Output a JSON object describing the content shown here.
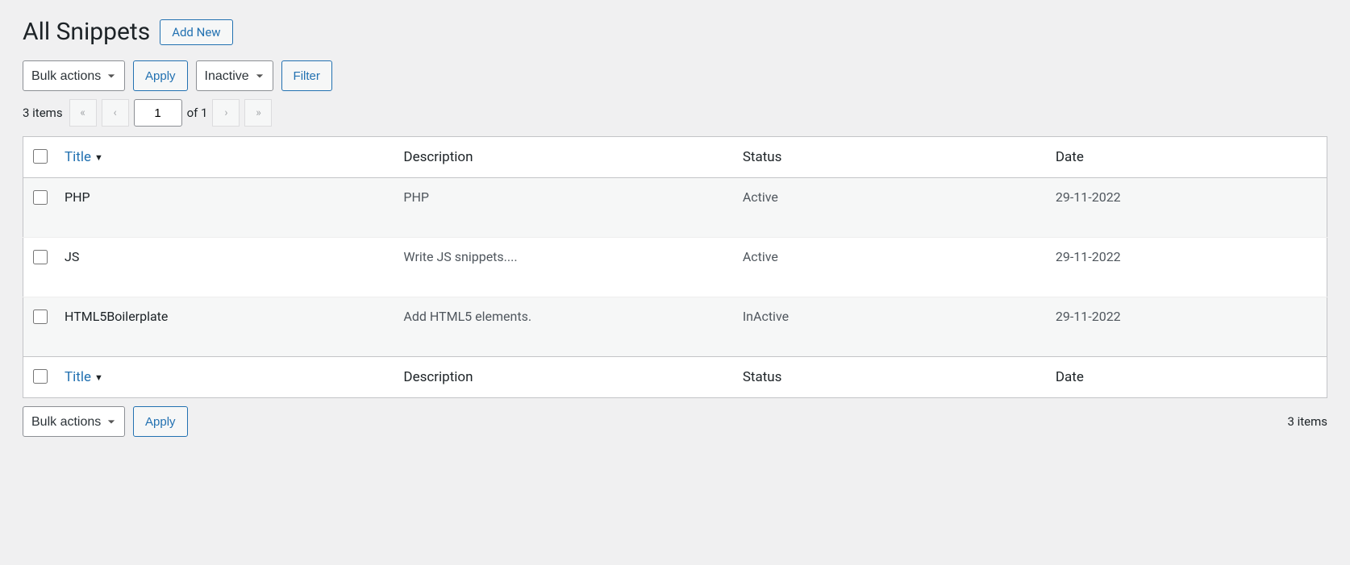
{
  "header": {
    "title": "All Snippets",
    "add_new_label": "Add New"
  },
  "bulk": {
    "label": "Bulk actions",
    "apply_label": "Apply"
  },
  "filter": {
    "selected": "Inactive",
    "button_label": "Filter"
  },
  "pagination": {
    "items_text": "3 items",
    "current_page": "1",
    "of_text": "of 1"
  },
  "columns": {
    "title": "Title",
    "description": "Description",
    "status": "Status",
    "date": "Date"
  },
  "rows": [
    {
      "title": "PHP",
      "description": "PHP",
      "status": "Active",
      "date": "29-11-2022"
    },
    {
      "title": "JS",
      "description": "Write JS snippets....",
      "status": "Active",
      "date": "29-11-2022"
    },
    {
      "title": "HTML5Boilerplate",
      "description": "Add HTML5 elements.",
      "status": "InActive",
      "date": "29-11-2022"
    }
  ],
  "footer": {
    "items_text": "3 items"
  }
}
